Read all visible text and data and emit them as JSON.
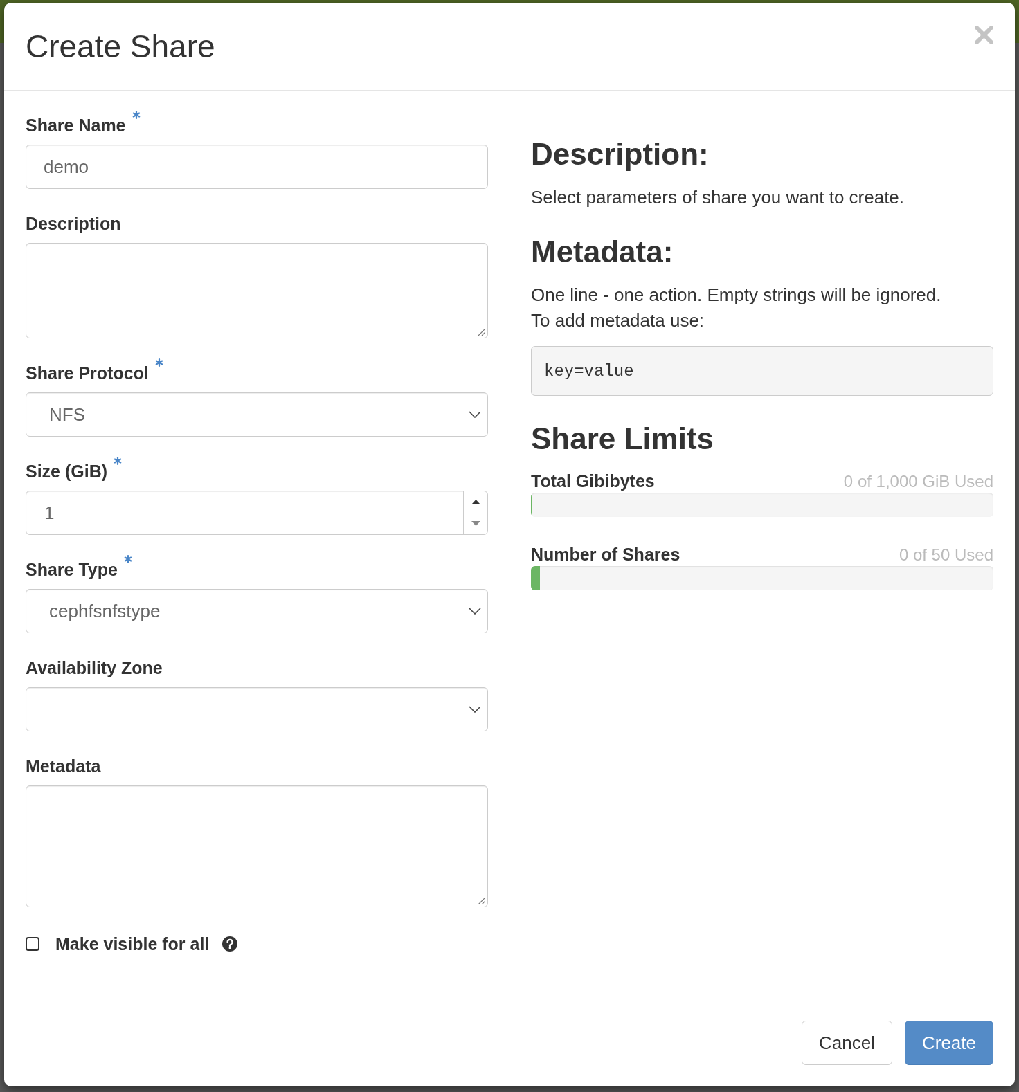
{
  "dialog": {
    "title": "Create Share"
  },
  "form": {
    "fields": [
      {
        "kind": "text",
        "label": "Share Name",
        "required": true,
        "value": "demo"
      },
      {
        "kind": "textarea",
        "label": "Description",
        "required": false
      },
      {
        "kind": "select",
        "label": "Share Protocol",
        "required": true,
        "value": "NFS"
      },
      {
        "kind": "number",
        "label": "Size (GiB)",
        "required": true,
        "value": "1"
      },
      {
        "kind": "select",
        "label": "Share Type",
        "required": true,
        "value": "cephfsnfstype"
      },
      {
        "kind": "select",
        "label": "Availability Zone",
        "required": false
      },
      {
        "kind": "textarea",
        "label": "Metadata",
        "required": false
      }
    ],
    "checkbox": {
      "label": "Make visible for all",
      "checked": false
    }
  },
  "help": {
    "sections": [
      {
        "heading": "Description:",
        "lines": [
          "Select parameters of share you want to create."
        ]
      },
      {
        "heading": "Metadata:",
        "lines": [
          "One line - one action. Empty strings will be ignored.",
          "To add metadata use:"
        ],
        "code": "key=value"
      }
    ]
  },
  "limits": {
    "heading": "Share Limits",
    "meters": [
      {
        "label": "Total Gibibytes",
        "reading": "0 of 1,000 GiB Used",
        "level": 0.001
      },
      {
        "label": "Number of Shares",
        "reading": "0 of 50 Used",
        "level": 0.02
      }
    ]
  },
  "footer": {
    "buttons": [
      {
        "label": "Cancel",
        "kind": "default"
      },
      {
        "label": "Create",
        "kind": "primary"
      }
    ]
  }
}
